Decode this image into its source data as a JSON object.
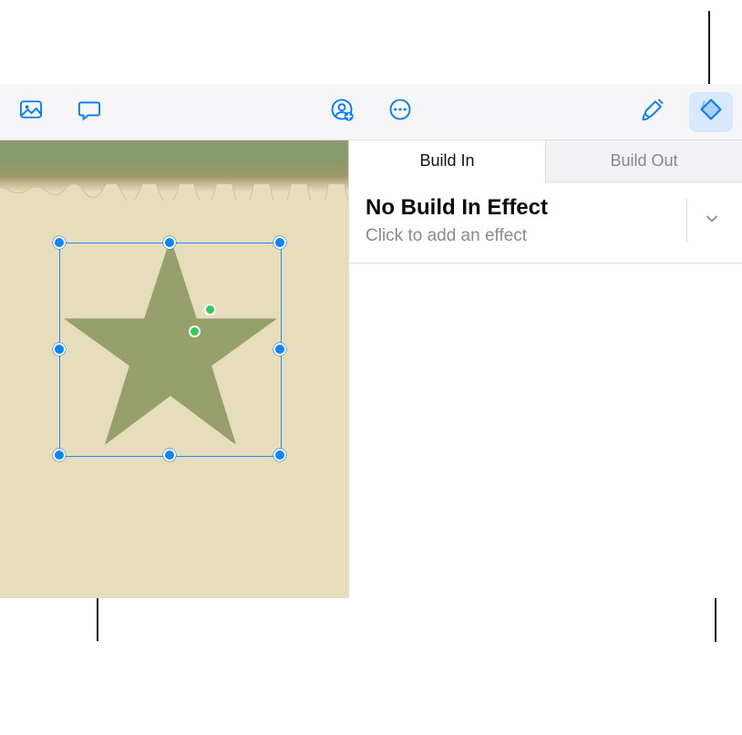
{
  "toolbar": {
    "media_icon": "media",
    "comment_icon": "comment",
    "collaborate_icon": "collaborate",
    "more_icon": "more",
    "format_icon": "format",
    "animate_icon": "animate"
  },
  "tabs": {
    "build_in": "Build In",
    "build_out": "Build Out",
    "active": "build_in"
  },
  "effect": {
    "title": "No Build In Effect",
    "subtitle": "Click to add an effect"
  },
  "canvas": {
    "selected_shape": "star"
  }
}
